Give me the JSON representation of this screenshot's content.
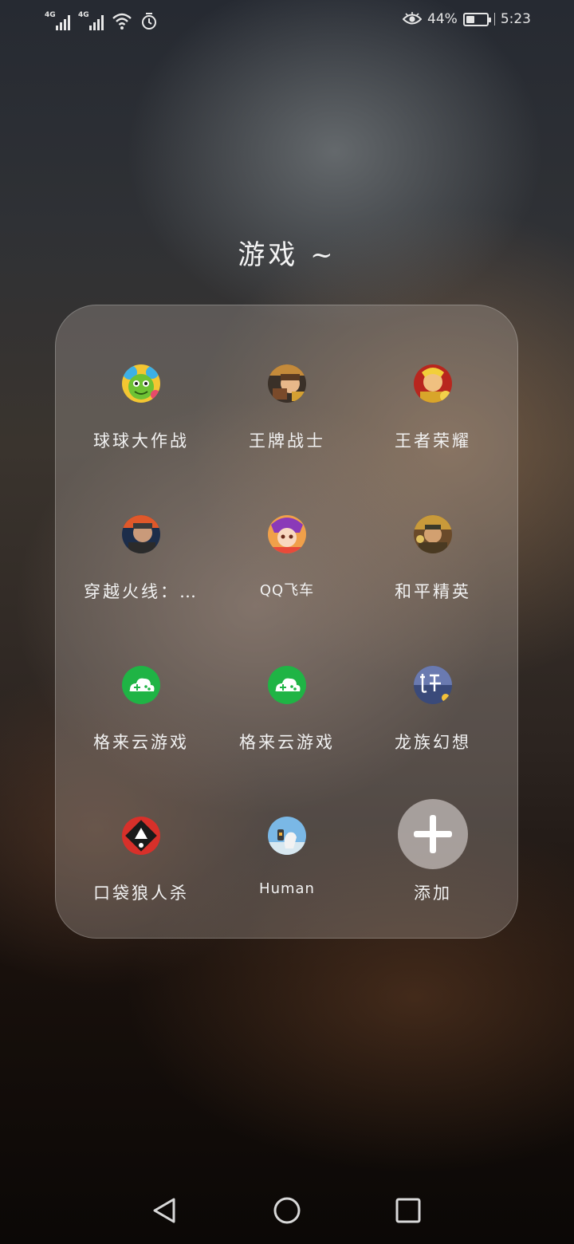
{
  "status_bar": {
    "network_1": "4G",
    "network_2": "4G",
    "battery_percent": "44%",
    "battery_level": 0.44,
    "time": "5:23",
    "icons": [
      "signal-icon",
      "signal-icon",
      "wifi-icon",
      "alarm-icon",
      "eye-comfort-icon",
      "battery-icon"
    ]
  },
  "folder": {
    "title": "游戏 ~",
    "apps": [
      {
        "label": "球球大作战",
        "icon": "ball-battle-icon"
      },
      {
        "label": "王牌战士",
        "icon": "ace-warrior-icon"
      },
      {
        "label": "王者荣耀",
        "icon": "honor-of-kings-icon"
      },
      {
        "label": "穿越火线：…",
        "icon": "crossfire-icon"
      },
      {
        "label": "QQ飞车",
        "icon": "qq-speed-icon"
      },
      {
        "label": "和平精英",
        "icon": "peace-elite-icon"
      },
      {
        "label": "格来云游戏",
        "icon": "gamepad-cloud-icon"
      },
      {
        "label": "格来云游戏",
        "icon": "gamepad-cloud-icon"
      },
      {
        "label": "龙族幻想",
        "icon": "dragon-raja-icon"
      },
      {
        "label": "口袋狼人杀",
        "icon": "pocket-werewolf-icon"
      },
      {
        "label": "Human",
        "icon": "human-fall-flat-icon"
      }
    ],
    "add_label": "添加"
  },
  "nav": {
    "icons": [
      "back-icon",
      "home-icon",
      "recents-icon"
    ]
  },
  "colors": {
    "cloud_game_green": "#1fb445",
    "panel_tint": "#beb4ac"
  }
}
